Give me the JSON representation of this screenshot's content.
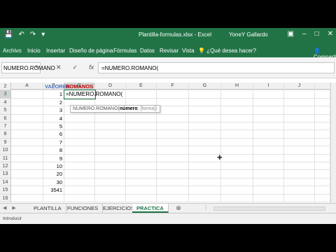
{
  "titlebar": {
    "title": "Plantilla-formulas.xlsx - Excel",
    "user": "YoneY Gallardo",
    "save_icon": "save-icon",
    "undo_icon": "undo-icon",
    "redo_icon": "redo-icon"
  },
  "ribbon": {
    "tabs": [
      "Archivo",
      "Inicio",
      "Insertar",
      "Diseño de página",
      "Fórmulas",
      "Datos",
      "Revisar",
      "Vista"
    ],
    "tell_me": "¿Qué desea hacer?",
    "share": "Compartir"
  },
  "formula_bar": {
    "name_box": "NUMERO.ROMANO",
    "cancel": "✕",
    "enter": "✓",
    "fx": "fx",
    "content": "=NUMERO.ROMANO("
  },
  "columns": [
    "A",
    "B",
    "C",
    "D",
    "E",
    "F",
    "G",
    "H",
    "I",
    "J"
  ],
  "rows": [
    {
      "n": "2",
      "b": "VALORES",
      "c": "ROMANOS"
    },
    {
      "n": "3",
      "b": "1",
      "c": "=NUMERO.ROMANO("
    },
    {
      "n": "4",
      "b": "2",
      "c": ""
    },
    {
      "n": "5",
      "b": "3",
      "c": ""
    },
    {
      "n": "6",
      "b": "4",
      "c": ""
    },
    {
      "n": "7",
      "b": "5",
      "c": ""
    },
    {
      "n": "8",
      "b": "6",
      "c": ""
    },
    {
      "n": "9",
      "b": "7",
      "c": ""
    },
    {
      "n": "10",
      "b": "8",
      "c": ""
    },
    {
      "n": "11",
      "b": "9",
      "c": ""
    },
    {
      "n": "12",
      "b": "10",
      "c": ""
    },
    {
      "n": "13",
      "b": "20",
      "c": ""
    },
    {
      "n": "14",
      "b": "30",
      "c": ""
    },
    {
      "n": "15",
      "b": "3541",
      "c": ""
    },
    {
      "n": "16",
      "b": "",
      "c": ""
    }
  ],
  "tooltip": {
    "fn": "NUMERO.ROMANO(",
    "arg": "número",
    "opt": "; [forma])"
  },
  "sheets": [
    "PLANTILLA",
    "FUNCIONES",
    "EJERCICIOS",
    "PRACTICA"
  ],
  "active_sheet": "PRACTICA",
  "status": "Introducir",
  "colors": {
    "accent": "#217346",
    "header_blue": "#4472c4",
    "header_red": "#c00000"
  }
}
